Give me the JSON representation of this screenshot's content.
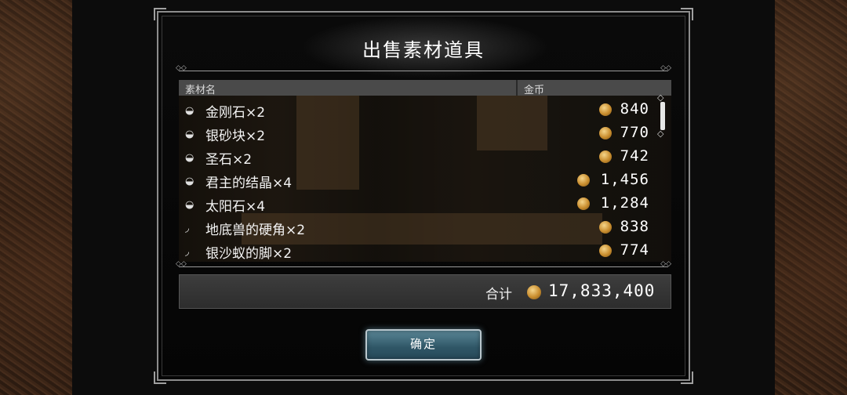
{
  "dialog": {
    "title": "出售素材道具",
    "columns": {
      "name": "素材名",
      "price": "金币"
    },
    "items": [
      {
        "name": "金刚石×2",
        "price": "840",
        "icon": "ore-icon"
      },
      {
        "name": "银砂块×2",
        "price": "770",
        "icon": "ore-icon"
      },
      {
        "name": "圣石×2",
        "price": "742",
        "icon": "ore-icon"
      },
      {
        "name": "君主的结晶×4",
        "price": "1,456",
        "icon": "ore-icon"
      },
      {
        "name": "太阳石×4",
        "price": "1,284",
        "icon": "ore-icon"
      },
      {
        "name": "地底兽的硬角×2",
        "price": "838",
        "icon": "horn-icon"
      },
      {
        "name": "银沙蚁的脚×2",
        "price": "774",
        "icon": "horn-icon"
      }
    ],
    "total": {
      "label": "合计",
      "value": "17,833,400"
    },
    "confirm_label": "确定"
  },
  "colors": {
    "coin": "#c98d2e",
    "button": "#2f5666",
    "header": "#4a4a4a"
  }
}
